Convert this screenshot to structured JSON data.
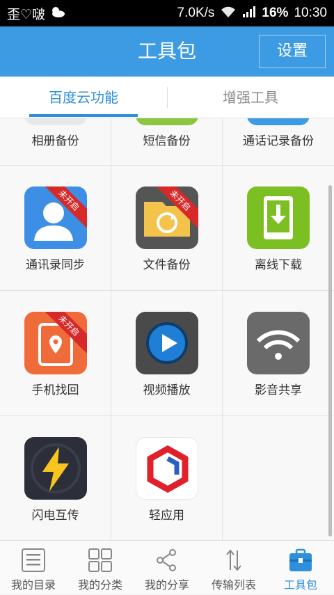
{
  "status_bar": {
    "left_text": "歪♡啵",
    "speed": "7.0K/s",
    "battery": "16%",
    "time": "10:30"
  },
  "header": {
    "title": "工具包",
    "settings_label": "设置"
  },
  "tabs": [
    {
      "label": "百度云功能"
    },
    {
      "label": "增强工具"
    }
  ],
  "grid": {
    "partial_row": [
      {
        "label": "相册备份",
        "color": "#e8e8e8"
      },
      {
        "label": "短信备份",
        "color": "#8cc63e"
      },
      {
        "label": "通话记录备份",
        "color": "#3d9be3"
      }
    ],
    "rows": [
      [
        {
          "label": "通讯录同步",
          "icon": "contacts-sync-icon",
          "color": "#3d8fe6",
          "ribbon": "未开启"
        },
        {
          "label": "文件备份",
          "icon": "file-backup-icon",
          "color": "#555555",
          "ribbon": "未开启"
        },
        {
          "label": "离线下载",
          "icon": "offline-download-icon",
          "color": "#7bbf22"
        }
      ],
      [
        {
          "label": "手机找回",
          "icon": "phone-find-icon",
          "color": "#ef6b3a",
          "ribbon": "未开启"
        },
        {
          "label": "视频播放",
          "icon": "video-play-icon",
          "color": "#4a4a4a"
        },
        {
          "label": "影音共享",
          "icon": "media-share-icon",
          "color": "#6a6a6a"
        }
      ],
      [
        {
          "label": "闪电互传",
          "icon": "lightning-transfer-icon",
          "color": "#2c2f3a"
        },
        {
          "label": "轻应用",
          "icon": "light-app-icon",
          "color": "#ffffff"
        }
      ]
    ]
  },
  "bottom_nav": [
    {
      "label": "我的目录",
      "icon": "list-icon"
    },
    {
      "label": "我的分类",
      "icon": "grid-icon"
    },
    {
      "label": "我的分享",
      "icon": "share-icon"
    },
    {
      "label": "传输列表",
      "icon": "transfer-icon"
    },
    {
      "label": "工具包",
      "icon": "toolbox-icon",
      "active": true
    }
  ]
}
